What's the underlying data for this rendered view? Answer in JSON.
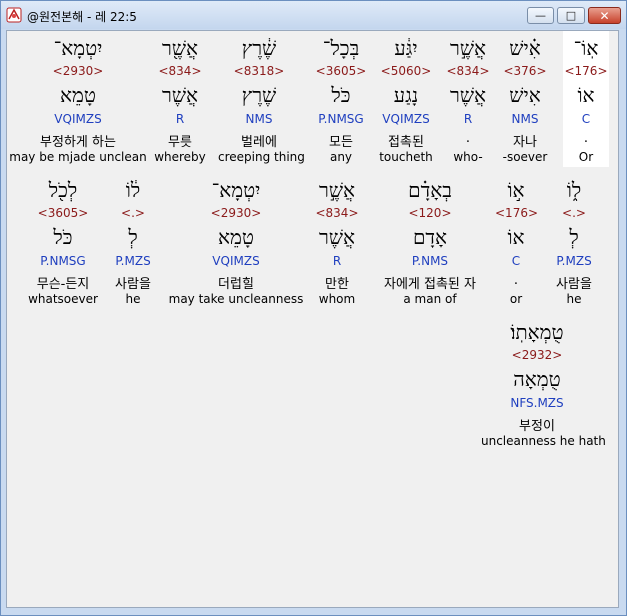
{
  "window": {
    "title": "@원전본해 - 레 22:5",
    "min_glyph": "—",
    "max_glyph": "□",
    "close_glyph": "✕"
  },
  "rows": [
    [
      {
        "heb": "אֽוֹ־",
        "strong": "<176>",
        "lemma": "אוֹ",
        "morph": "C",
        "kor": ".",
        "eng": "Or",
        "selected": true
      },
      {
        "heb": "אִ֗ישׁ",
        "strong": "<376>",
        "lemma": "אִישׁ",
        "morph": "NMS",
        "kor": "자나",
        "eng": "-soever"
      },
      {
        "heb": "אֲשֶׁ֣ר",
        "strong": "<834>",
        "lemma": "אֲשֶׁר",
        "morph": "R",
        "kor": ".",
        "eng": "who-"
      },
      {
        "heb": "יִגַּ֔ע",
        "strong": "<5060>",
        "lemma": "נָגַע",
        "morph": "VQIMZS",
        "kor": "접촉된",
        "eng": "toucheth"
      },
      {
        "heb": "בְּכָל־",
        "strong": "<3605>",
        "lemma": "כֹּל",
        "morph": "P.NMSG",
        "kor": "모든",
        "eng": "any"
      },
      {
        "heb": "שֶׁ֔רֶץ",
        "strong": "<8318>",
        "lemma": "שֶׁרֶץ",
        "morph": "NMS",
        "kor": "벌레에",
        "eng": "creeping thing"
      },
      {
        "heb": "אֲשֶׁ֖ר",
        "strong": "<834>",
        "lemma": "אֲשֶׁר",
        "morph": "R",
        "kor": "무릇",
        "eng": "whereby"
      },
      {
        "heb": "יִטְמָא־",
        "strong": "<2930>",
        "lemma": "טָמֵא",
        "morph": "VQIMZS",
        "kor": "부정하게 하는",
        "eng": "may be mjade unclean"
      }
    ],
    [
      {
        "heb": "ל֑וֹ",
        "strong": "<.>",
        "lemma": "לְ",
        "morph": "P.MZS",
        "kor": "사람을",
        "eng": "he"
      },
      {
        "heb": "א֣וֹ",
        "strong": "<176>",
        "lemma": "אוֹ",
        "morph": "C",
        "kor": ".",
        "eng": "or"
      },
      {
        "heb": "בְאָדָ֗ם",
        "strong": "<120>",
        "lemma": "אָדָם",
        "morph": "P.NMS",
        "kor": "자에게 접촉된 자",
        "eng": "a man of"
      },
      {
        "heb": "אֲשֶׁ֣ר",
        "strong": "<834>",
        "lemma": "אֲשֶׁר",
        "morph": "R",
        "kor": "만한",
        "eng": "whom"
      },
      {
        "heb": "יִטְמָא־",
        "strong": "<2930>",
        "lemma": "טָמֵא",
        "morph": "VQIMZS",
        "kor": "더럽힐",
        "eng": "may take uncleanness"
      },
      {
        "heb": "ל֔וֹ",
        "strong": "<.>",
        "lemma": "לְ",
        "morph": "P.MZS",
        "kor": "사람을",
        "eng": "he"
      },
      {
        "heb": "לְכֹ֖ל",
        "strong": "<3605>",
        "lemma": "כֹּל",
        "morph": "P.NMSG",
        "kor": "무슨-든지",
        "eng": "whatsoever"
      }
    ],
    [
      {
        "heb": "טֻמְאָתֽוֹ׃",
        "strong": "<2932>",
        "lemma": "טֻמְאָה",
        "morph": "NFS.MZS",
        "kor": "부정이",
        "eng": "uncleanness he hath"
      }
    ]
  ]
}
